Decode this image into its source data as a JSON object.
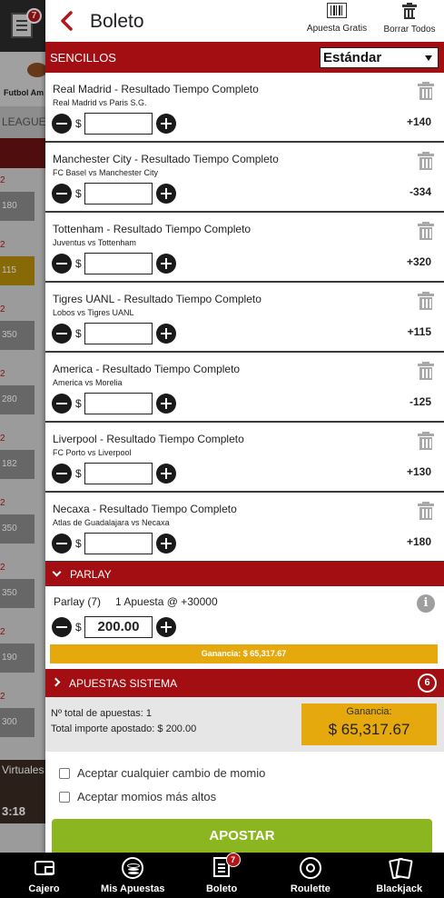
{
  "background": {
    "badge_count": "7",
    "sport_label": "Futbol Am",
    "league_label": "LEAGUE",
    "rows": [
      {
        "num": "2",
        "odd": "180",
        "highlight": false
      },
      {
        "num": "2",
        "odd": "115",
        "highlight": true
      },
      {
        "num": "2",
        "odd": "350",
        "highlight": false
      },
      {
        "num": "2",
        "odd": "280",
        "highlight": false
      },
      {
        "num": "2",
        "odd": "182",
        "highlight": false
      },
      {
        "num": "2",
        "odd": "350",
        "highlight": false
      },
      {
        "num": "2",
        "odd": "350",
        "highlight": false
      },
      {
        "num": "2",
        "odd": "190",
        "highlight": false
      },
      {
        "num": "2",
        "odd": "300",
        "highlight": false
      }
    ],
    "virtual_label": "Virtuales",
    "virtual_time": "3:18"
  },
  "header": {
    "title": "Boleto",
    "free_bet_label": "Apuesta Gratis",
    "clear_all_label": "Borrar Todos"
  },
  "singles": {
    "label": "SENCILLOS",
    "mode_selected": "Estándar"
  },
  "bets": [
    {
      "market": "Real Madrid - Resultado Tiempo Completo",
      "event": "Real Madrid vs Paris S.G.",
      "odds": "+140",
      "currency": "$",
      "amount": ""
    },
    {
      "market": "Manchester City - Resultado Tiempo Completo",
      "event": "FC Basel vs Manchester City",
      "odds": "-334",
      "currency": "$",
      "amount": ""
    },
    {
      "market": "Tottenham - Resultado Tiempo Completo",
      "event": "Juventus vs Tottenham",
      "odds": "+320",
      "currency": "$",
      "amount": ""
    },
    {
      "market": "Tigres UANL - Resultado Tiempo Completo",
      "event": "Lobos vs Tigres UANL",
      "odds": "+115",
      "currency": "$",
      "amount": ""
    },
    {
      "market": "America - Resultado Tiempo Completo",
      "event": "America vs Morelia",
      "odds": "-125",
      "currency": "$",
      "amount": ""
    },
    {
      "market": "Liverpool - Resultado Tiempo Completo",
      "event": "FC Porto vs Liverpool",
      "odds": "+130",
      "currency": "$",
      "amount": ""
    },
    {
      "market": "Necaxa - Resultado Tiempo Completo",
      "event": "Atlas de Guadalajara vs Necaxa",
      "odds": "+180",
      "currency": "$",
      "amount": ""
    }
  ],
  "parlay": {
    "label": "PARLAY",
    "count_label": "Parlay (7)",
    "bets_label": "1 Apuesta @ +30000",
    "currency": "$",
    "amount": "200.00",
    "gain_label": "Ganancia: $ 65,317.67"
  },
  "system": {
    "label": "APUESTAS SISTEMA",
    "count": "6"
  },
  "totals": {
    "total_bets": "Nº total de apuestas: 1",
    "total_amount": "Total importe apostado: $ 200.00",
    "gain_label": "Ganancia:",
    "gain_value": "$ 65,317.67"
  },
  "options": {
    "accept_any": "Aceptar cualquier cambio de momio",
    "accept_higher": "Aceptar momios más altos",
    "submit_label": "APOSTAR"
  },
  "bottom_nav": [
    {
      "label": "Cajero",
      "icon": "wallet-icon"
    },
    {
      "label": "Mis Apuestas",
      "icon": "chips-icon"
    },
    {
      "label": "Boleto",
      "icon": "betslip-icon",
      "badge": "7"
    },
    {
      "label": "Roulette",
      "icon": "roulette-icon"
    },
    {
      "label": "Blackjack",
      "icon": "cards-icon"
    }
  ],
  "colors": {
    "brand_red": "#a30e12",
    "gold": "#e5a90e",
    "submit_green": "#8bb61f"
  }
}
